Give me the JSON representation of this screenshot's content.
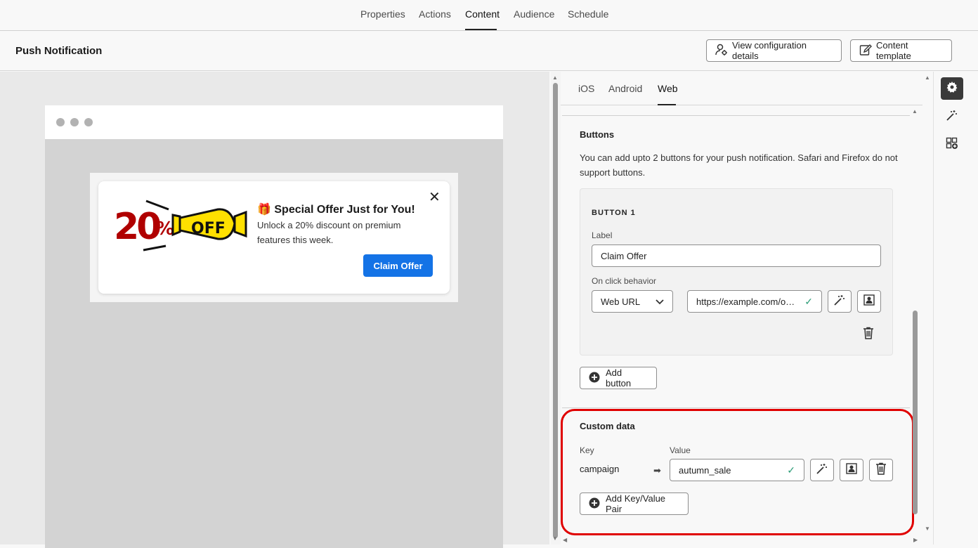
{
  "topnav": {
    "tabs": [
      "Properties",
      "Actions",
      "Content",
      "Audience",
      "Schedule"
    ],
    "active": "Content"
  },
  "header": {
    "title": "Push Notification",
    "view_config_label": "View configuration details",
    "content_template_label": "Content template"
  },
  "notification": {
    "badge_text": "20% OFF",
    "title": "🎁 Special Offer Just for You!",
    "body": "Unlock a 20% discount on premium features this week.",
    "cta_label": "Claim Offer",
    "close_glyph": "✕"
  },
  "platform_tabs": [
    "iOS",
    "Android",
    "Web"
  ],
  "active_platform": "Web",
  "buttons_section": {
    "title": "Buttons",
    "description": "You can add upto 2 buttons for your push notification. Safari and Firefox do not support buttons.",
    "button1": {
      "heading": "BUTTON 1",
      "label_caption": "Label",
      "label_value": "Claim Offer",
      "onclick_caption": "On click behavior",
      "onclick_value": "Web URL",
      "url_value": "https://example.com/o…"
    },
    "add_button_label": "Add button"
  },
  "custom_data": {
    "title": "Custom data",
    "key_caption": "Key",
    "value_caption": "Value",
    "key": "campaign",
    "value": "autumn_sale",
    "add_pair_label": "Add Key/Value Pair"
  },
  "colors": {
    "accent_blue": "#1473e6",
    "highlight_red": "#e00000",
    "valid_green": "#2d9d78"
  }
}
